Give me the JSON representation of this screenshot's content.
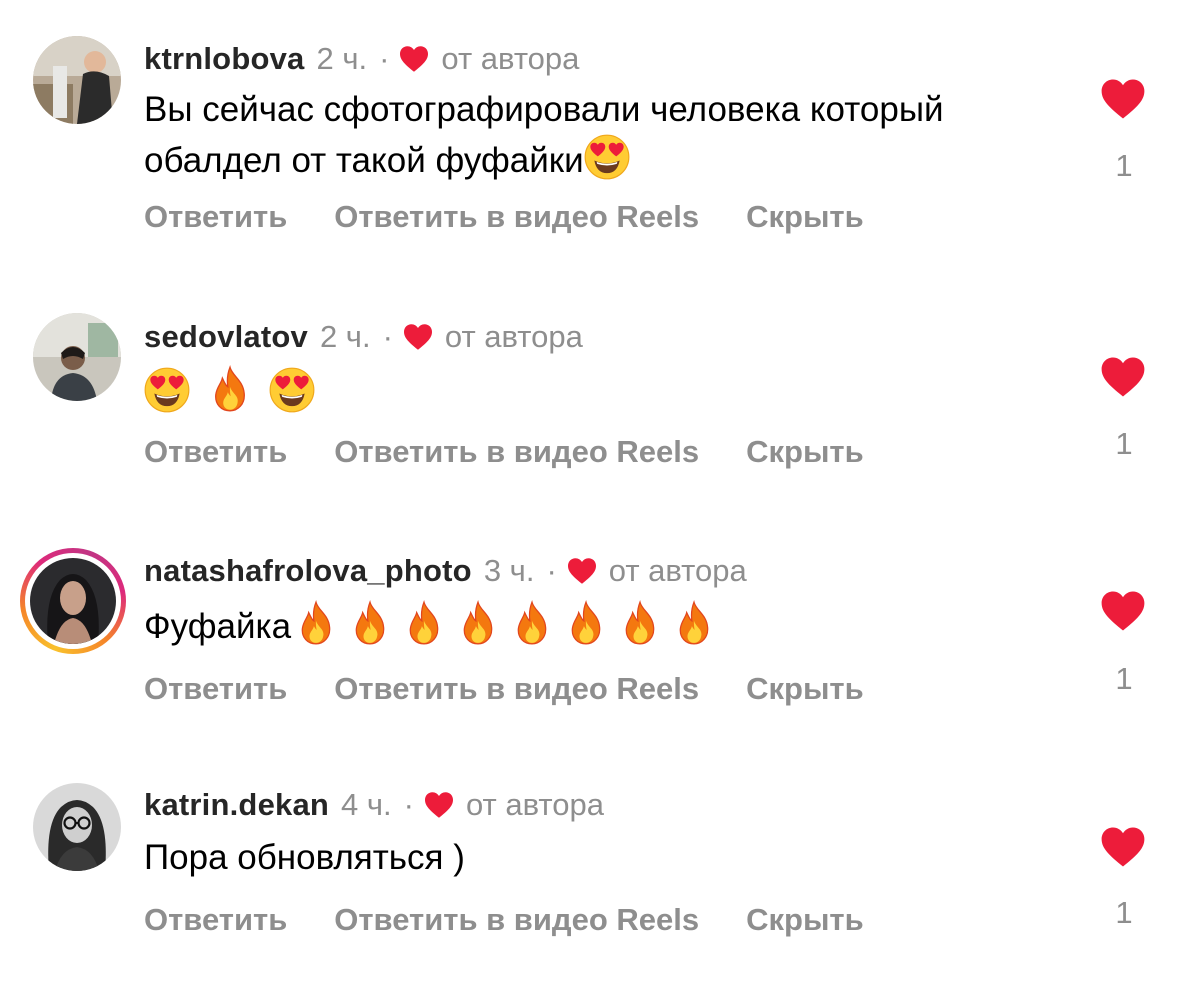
{
  "colors": {
    "heart": "#ed1c3a",
    "meta": "#8e8e8e",
    "username": "#262626"
  },
  "actions": {
    "reply": "Ответить",
    "reply_reels": "Ответить в видео Reels",
    "hide": "Скрыть"
  },
  "comments": [
    {
      "username": "ktrnlobova",
      "time": "2 ч.",
      "dot": "·",
      "by_author": "от автора",
      "text_line1": "Вы сейчас сфотографировали человека который",
      "text_line2": "обалдел от такой фуфайки",
      "emoji": [
        "heart-eyes-emoji"
      ],
      "likes": "1"
    },
    {
      "username": "sedovlatov",
      "time": "2 ч.",
      "dot": "·",
      "by_author": "от автора",
      "emoji": [
        "heart-eyes-emoji",
        "fire-emoji",
        "heart-eyes-emoji"
      ],
      "likes": "1"
    },
    {
      "username": "natashafrolova_photo",
      "time": "3 ч.",
      "dot": "·",
      "by_author": "от автора",
      "text": "Фуфайка",
      "emoji": [
        "fire-emoji",
        "fire-emoji",
        "fire-emoji",
        "fire-emoji",
        "fire-emoji",
        "fire-emoji",
        "fire-emoji",
        "fire-emoji"
      ],
      "has_story": true,
      "likes": "1"
    },
    {
      "username": "katrin.dekan",
      "time": "4 ч.",
      "dot": "·",
      "by_author": "от автора",
      "text": "Пора обновляться )",
      "likes": "1"
    }
  ]
}
